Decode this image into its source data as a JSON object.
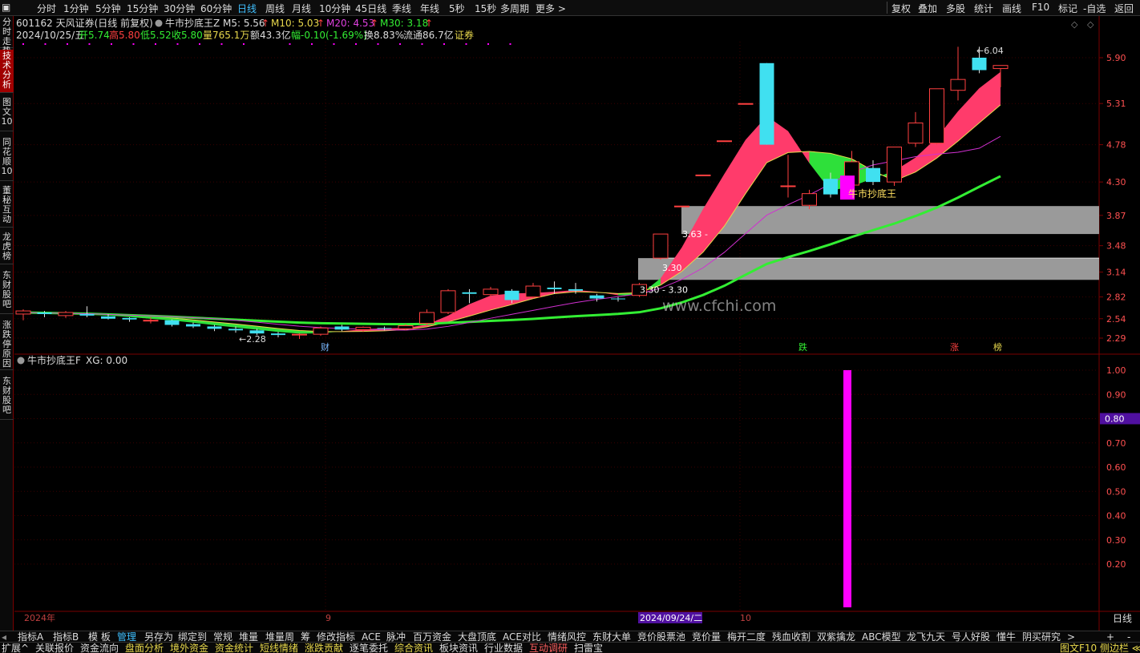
{
  "topbar": {
    "timeframes": [
      "分时",
      "1分钟",
      "5分钟",
      "15分钟",
      "30分钟",
      "60分钟",
      "日线",
      "周线",
      "月线",
      "10分钟",
      "45日线",
      "季线",
      "年线",
      "5秒",
      "15秒",
      "多周期",
      "更多 >"
    ],
    "active_timeframe": "日线",
    "right_buttons": [
      "复权",
      "叠加",
      "多股",
      "统计",
      "画线",
      "F10",
      "标记",
      "-自选",
      "返回"
    ]
  },
  "leftbar": {
    "tabs": [
      "分时走势",
      "技术分析",
      "图文10",
      "同花顺10",
      "董秘互动",
      "龙虎榜",
      "东财股吧",
      "涨跌停原因",
      "东财股吧"
    ],
    "active_tab": "技术分析"
  },
  "header": {
    "stock": "601162 天风证券(日线 前复权)",
    "indicator_name": "牛市抄底王Z",
    "ma5": "M5: 5.56",
    "ma10": "M10: 5.03",
    "ma20": "M20: 4.53",
    "ma30": "M30: 3.18",
    "date": "2024/10/25/五",
    "open": "开5.74",
    "high": "高5.80",
    "low": "低5.52",
    "close": "收5.80",
    "volume": "量765.1万",
    "amount": "额43.3亿",
    "change": "幅-0.10(-1.69%)",
    "turnover": "换8.83%",
    "float": "流通86.7亿",
    "sector": "证券"
  },
  "lower_header": {
    "indicator": "牛市抄底王F",
    "xg": "XG: 0.00"
  },
  "colors": {
    "up": "#ff4040",
    "down": "#40e0f0",
    "ribbon_up": "#ff3b6b",
    "ribbon_down": "#2ee03a",
    "ma_long": "#33ee33",
    "ma_purple": "#d030d0",
    "signal": "#ff00ff",
    "accent": "#40c0ff"
  },
  "chart_data": {
    "type": "candlestick",
    "y_ticks": [
      "5.90",
      "5.31",
      "4.78",
      "4.30",
      "3.87",
      "3.48",
      "3.14",
      "2.82",
      "2.54",
      "2.29"
    ],
    "lower_y_ticks": [
      "1.00",
      "0.90",
      "0.80",
      "0.70",
      "0.60",
      "0.50",
      "0.40",
      "0.30",
      "0.20"
    ],
    "lower_current": "0.80",
    "x_labels": [
      "2024年",
      "9",
      "2024/09/24/二",
      "10"
    ],
    "annotations": {
      "low": "2.28",
      "high": "6.04",
      "zone1_label": "3.63",
      "zone2_label": "3.30",
      "zone2_label_b": "3.30 - 3.30",
      "signal_text": "牛市抄底王",
      "watermark": "www.cfchi.com"
    },
    "event_tags": [
      "财",
      "跌",
      "涨",
      "榜"
    ],
    "candles": [
      {
        "o": 2.6,
        "h": 2.66,
        "l": 2.52,
        "c": 2.64
      },
      {
        "o": 2.62,
        "h": 2.64,
        "l": 2.56,
        "c": 2.6
      },
      {
        "o": 2.58,
        "h": 2.64,
        "l": 2.55,
        "c": 2.62
      },
      {
        "o": 2.6,
        "h": 2.7,
        "l": 2.56,
        "c": 2.58
      },
      {
        "o": 2.57,
        "h": 2.6,
        "l": 2.53,
        "c": 2.54
      },
      {
        "o": 2.55,
        "h": 2.56,
        "l": 2.5,
        "c": 2.53
      },
      {
        "o": 2.52,
        "h": 2.56,
        "l": 2.48,
        "c": 2.52
      },
      {
        "o": 2.52,
        "h": 2.53,
        "l": 2.44,
        "c": 2.46
      },
      {
        "o": 2.47,
        "h": 2.49,
        "l": 2.42,
        "c": 2.44
      },
      {
        "o": 2.44,
        "h": 2.46,
        "l": 2.38,
        "c": 2.41
      },
      {
        "o": 2.41,
        "h": 2.44,
        "l": 2.36,
        "c": 2.39
      },
      {
        "o": 2.39,
        "h": 2.41,
        "l": 2.33,
        "c": 2.35
      },
      {
        "o": 2.35,
        "h": 2.37,
        "l": 2.3,
        "c": 2.33
      },
      {
        "o": 2.33,
        "h": 2.35,
        "l": 2.28,
        "c": 2.34
      },
      {
        "o": 2.34,
        "h": 2.44,
        "l": 2.32,
        "c": 2.42
      },
      {
        "o": 2.44,
        "h": 2.46,
        "l": 2.38,
        "c": 2.4
      },
      {
        "o": 2.4,
        "h": 2.44,
        "l": 2.37,
        "c": 2.43
      },
      {
        "o": 2.42,
        "h": 2.44,
        "l": 2.39,
        "c": 2.41
      },
      {
        "o": 2.41,
        "h": 2.47,
        "l": 2.39,
        "c": 2.45
      },
      {
        "o": 2.48,
        "h": 2.66,
        "l": 2.45,
        "c": 2.62
      },
      {
        "o": 2.62,
        "h": 2.92,
        "l": 2.6,
        "c": 2.9
      },
      {
        "o": 2.88,
        "h": 2.92,
        "l": 2.74,
        "c": 2.86
      },
      {
        "o": 2.85,
        "h": 2.95,
        "l": 2.82,
        "c": 2.92
      },
      {
        "o": 2.9,
        "h": 2.92,
        "l": 2.74,
        "c": 2.78
      },
      {
        "o": 2.82,
        "h": 3.0,
        "l": 2.8,
        "c": 2.96
      },
      {
        "o": 2.94,
        "h": 3.02,
        "l": 2.86,
        "c": 2.92
      },
      {
        "o": 2.92,
        "h": 3.0,
        "l": 2.86,
        "c": 2.9
      },
      {
        "o": 2.84,
        "h": 2.86,
        "l": 2.76,
        "c": 2.8
      },
      {
        "o": 2.8,
        "h": 2.82,
        "l": 2.76,
        "c": 2.79
      },
      {
        "o": 2.84,
        "h": 3.0,
        "l": 2.82,
        "c": 2.98
      },
      {
        "o": 3.32,
        "h": 3.63,
        "l": 3.3,
        "c": 3.63
      },
      {
        "o": 3.99,
        "h": 3.99,
        "l": 3.99,
        "c": 3.99
      },
      {
        "o": 4.39,
        "h": 4.39,
        "l": 4.39,
        "c": 4.39
      },
      {
        "o": 4.83,
        "h": 4.83,
        "l": 4.83,
        "c": 4.83
      },
      {
        "o": 5.31,
        "h": 5.31,
        "l": 5.31,
        "c": 5.31
      },
      {
        "o": 5.83,
        "h": 5.83,
        "l": 4.78,
        "c": 4.78
      },
      {
        "o": 4.25,
        "h": 4.65,
        "l": 4.1,
        "c": 4.25
      },
      {
        "o": 4.0,
        "h": 4.2,
        "l": 3.95,
        "c": 4.15
      },
      {
        "o": 4.34,
        "h": 4.42,
        "l": 4.1,
        "c": 4.14
      },
      {
        "o": 4.26,
        "h": 4.7,
        "l": 4.22,
        "c": 4.56
      },
      {
        "o": 4.48,
        "h": 4.58,
        "l": 4.26,
        "c": 4.3
      },
      {
        "o": 4.3,
        "h": 4.7,
        "l": 4.25,
        "c": 4.75
      },
      {
        "o": 4.8,
        "h": 5.2,
        "l": 4.75,
        "c": 5.06
      },
      {
        "o": 4.8,
        "h": 5.5,
        "l": 4.78,
        "c": 5.5
      },
      {
        "o": 5.48,
        "h": 6.04,
        "l": 5.35,
        "c": 5.62
      },
      {
        "o": 5.9,
        "h": 6.04,
        "l": 5.7,
        "c": 5.74
      },
      {
        "o": 5.76,
        "h": 5.8,
        "l": 5.52,
        "c": 5.8
      }
    ]
  },
  "bottom_bar1": {
    "tabs": [
      "指标A",
      "指标B",
      "模 板",
      "管理",
      "另存为",
      "绑定到",
      "常规",
      "堆量",
      "堆量周",
      "筹",
      "修改指标",
      "ACE",
      "脉冲",
      "百万资金",
      "大盘顶底",
      "ACE对比",
      "情绪风控",
      "东财大单",
      "竞价股票池",
      "竞价量",
      "梅开二度",
      "残血收割",
      "双紫擒龙",
      "ABC模型",
      "龙飞九天",
      "号人好股",
      "懂牛",
      "阴买研究",
      ">"
    ],
    "active": "管理",
    "right_label": "日线",
    "plus": "+",
    "minus": "-"
  },
  "bottom_bar2": {
    "tabs": [
      "扩展^",
      "关联报价",
      "资金流向",
      "盘面分析",
      "境外资金",
      "资金统计",
      "短线情绪",
      "涨跌贡献",
      "逐笔委托",
      "综合资讯",
      "板块资讯",
      "行业数据",
      "互动调研",
      "扫雷宝"
    ],
    "right_label": "图文F10 侧边栏 ≪"
  }
}
